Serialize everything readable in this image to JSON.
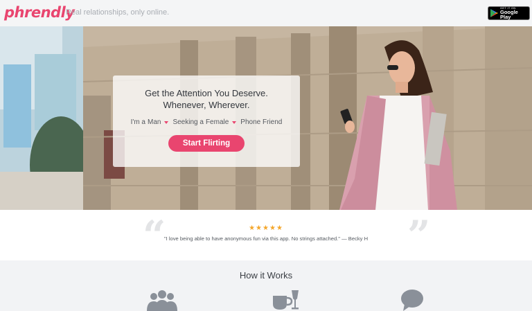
{
  "header": {
    "logo": "phrendly",
    "tagline": "Real relationships, only online.",
    "store_badge": {
      "small": "GET IT ON",
      "big": "Google Play"
    }
  },
  "hero": {
    "title_line1": "Get the Attention You Deserve.",
    "title_line2": "Whenever, Wherever.",
    "im_a": "I'm a",
    "gender": "Man",
    "seeking_a": "Seeking a",
    "seeking": "Female",
    "friend_type": "Phone Friend",
    "cta": "Start Flirting"
  },
  "testimonial": {
    "stars": "★★★★★",
    "quote": "\"I love being able to have anonymous fun via this app. No strings attached.\" — Becky H"
  },
  "how_it_works": {
    "title": "How it Works",
    "icons": [
      "people-icon",
      "drinks-icon",
      "chat-icon"
    ]
  },
  "colors": {
    "brand": "#e9456f",
    "star": "#f4a62a"
  }
}
